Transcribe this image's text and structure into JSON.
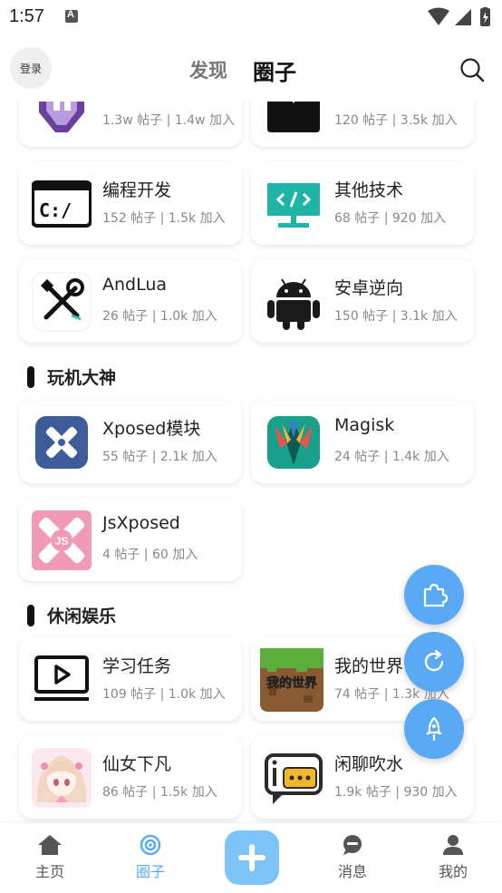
{
  "status_bar": {
    "time": "1:57"
  },
  "header": {
    "login_label": "登录",
    "tab_discover": "发现",
    "tab_circle": "圈子"
  },
  "sections": [
    {
      "title": "玩机大神"
    },
    {
      "title": "休闲娱乐"
    }
  ],
  "cards": [
    {
      "title": "",
      "stats": "1.3w 帖子 | 1.4w 加入",
      "icon": "purple-app-icon"
    },
    {
      "title": "",
      "stats": "120 帖子 | 3.5k 加入",
      "icon": "dark-tshirt-icon"
    },
    {
      "title": "编程开发",
      "stats": "152 帖子 | 1.5k 加入",
      "icon": "terminal-icon"
    },
    {
      "title": "其他技术",
      "stats": "68 帖子 | 920 加入",
      "icon": "code-monitor-icon"
    },
    {
      "title": "AndLua",
      "stats": "26 帖子 | 1.0k 加入",
      "icon": "tools-icon"
    },
    {
      "title": "安卓逆向",
      "stats": "150 帖子 | 3.1k 加入",
      "icon": "android-icon"
    },
    {
      "title": "Xposed模块",
      "stats": "55 帖子 | 2.1k 加入",
      "icon": "xposed-icon"
    },
    {
      "title": "Magisk",
      "stats": "24 帖子 | 1.4k 加入",
      "icon": "magisk-icon"
    },
    {
      "title": "JsXposed",
      "stats": "4 帖子 | 60 加入",
      "icon": "jsxposed-icon"
    },
    {
      "title": "学习任务",
      "stats": "109 帖子 | 1.0k 加入",
      "icon": "video-play-icon"
    },
    {
      "title": "我的世界",
      "stats": "74 帖子 | 1.3k 加入",
      "icon": "minecraft-icon"
    },
    {
      "title": "仙女下凡",
      "stats": "86 帖子 | 1.5k 加入",
      "icon": "anime-avatar-icon"
    },
    {
      "title": "闲聊吹水",
      "stats": "1.9k 帖子 | 930 加入",
      "icon": "chat-bubble-icon"
    }
  ],
  "minecraft_badge": "我的世界",
  "jsxposed_badge": "JS",
  "bottom_nav": {
    "home": "主页",
    "circle": "圈子",
    "messages": "消息",
    "mine": "我的"
  },
  "colors": {
    "accent": "#5aa9f5",
    "center_button": "#7ec3f8"
  }
}
